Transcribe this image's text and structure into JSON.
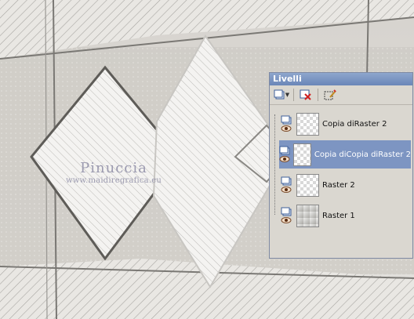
{
  "watermark": {
    "name": "Pinuccia",
    "url": "www.maidiregrafica.eu"
  },
  "layers_panel": {
    "title": "Livelli",
    "toolbar": {
      "new_layer_icon": "new-raster-layer-icon",
      "delete_icon": "delete-layer-icon",
      "edit_selection_icon": "edit-selection-icon"
    },
    "layers": [
      {
        "name": "Copia diRaster 2",
        "selected": false,
        "thumb": "checker"
      },
      {
        "name": "Copia diCopia diRaster 2",
        "selected": true,
        "thumb": "checker"
      },
      {
        "name": "Raster 2",
        "selected": false,
        "thumb": "checker"
      },
      {
        "name": "Raster 1",
        "selected": false,
        "thumb": "gradient"
      }
    ]
  },
  "colors": {
    "panel_title_bg": "#7d95c2",
    "panel_bg": "#dad7d0",
    "selected_row": "#7d95c2",
    "watermark_text": "#9c9bb0"
  }
}
